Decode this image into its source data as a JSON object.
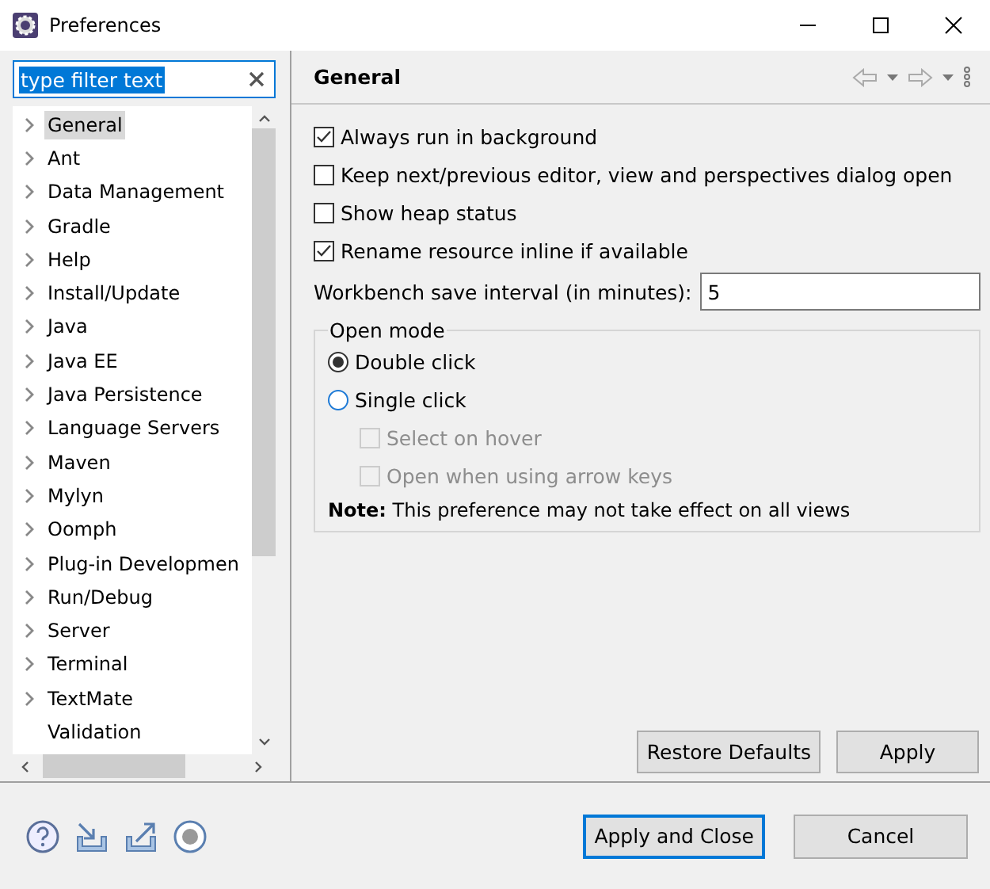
{
  "window": {
    "title": "Preferences"
  },
  "filter": {
    "value": "type filter text"
  },
  "tree": {
    "items": [
      {
        "label": "General",
        "expandable": true,
        "selected": true
      },
      {
        "label": "Ant",
        "expandable": true,
        "selected": false
      },
      {
        "label": "Data Management",
        "expandable": true,
        "selected": false
      },
      {
        "label": "Gradle",
        "expandable": true,
        "selected": false
      },
      {
        "label": "Help",
        "expandable": true,
        "selected": false
      },
      {
        "label": "Install/Update",
        "expandable": true,
        "selected": false
      },
      {
        "label": "Java",
        "expandable": true,
        "selected": false
      },
      {
        "label": "Java EE",
        "expandable": true,
        "selected": false
      },
      {
        "label": "Java Persistence",
        "expandable": true,
        "selected": false
      },
      {
        "label": "Language Servers",
        "expandable": true,
        "selected": false
      },
      {
        "label": "Maven",
        "expandable": true,
        "selected": false
      },
      {
        "label": "Mylyn",
        "expandable": true,
        "selected": false
      },
      {
        "label": "Oomph",
        "expandable": true,
        "selected": false
      },
      {
        "label": "Plug-in Developmen",
        "expandable": true,
        "selected": false
      },
      {
        "label": "Run/Debug",
        "expandable": true,
        "selected": false
      },
      {
        "label": "Server",
        "expandable": true,
        "selected": false
      },
      {
        "label": "Terminal",
        "expandable": true,
        "selected": false
      },
      {
        "label": "TextMate",
        "expandable": true,
        "selected": false
      },
      {
        "label": "Validation",
        "expandable": false,
        "selected": false
      }
    ]
  },
  "page": {
    "title": "General",
    "options": [
      {
        "label": "Always run in background",
        "checked": true
      },
      {
        "label": "Keep next/previous editor, view and perspectives dialog open",
        "checked": false
      },
      {
        "label": "Show heap status",
        "checked": false
      },
      {
        "label": "Rename resource inline if available",
        "checked": true
      }
    ],
    "save_interval": {
      "label": "Workbench save interval (in minutes):",
      "value": "5"
    },
    "open_mode": {
      "title": "Open mode",
      "choices": [
        {
          "label": "Double click",
          "selected": true
        },
        {
          "label": "Single click",
          "selected": false
        }
      ],
      "sub_options": [
        {
          "label": "Select on hover",
          "checked": false,
          "disabled": true
        },
        {
          "label": "Open when using arrow keys",
          "checked": false,
          "disabled": true
        }
      ],
      "note": "**Note:** This preference may not take effect on all views"
    },
    "buttons": [
      "Restore Defaults",
      "Apply"
    ]
  },
  "footer": {
    "buttons": [
      {
        "label": "Apply and Close",
        "default": true
      },
      {
        "label": "Cancel",
        "default": false
      }
    ]
  }
}
